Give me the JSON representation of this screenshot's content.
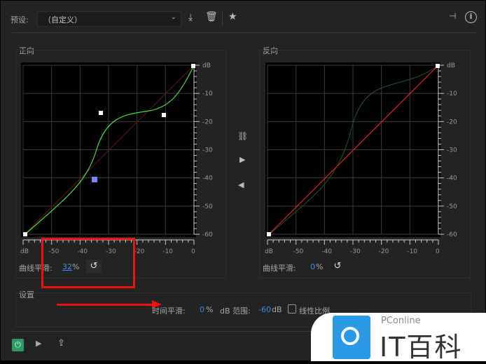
{
  "header": {
    "preset_label": "预设:",
    "preset_value": "（自定义）"
  },
  "forward": {
    "title": "正向",
    "smooth_label": "曲线平滑:",
    "smooth_value": "32",
    "unit": "%"
  },
  "reverse": {
    "title": "反向",
    "smooth_label": "曲线平滑:",
    "smooth_value": "0",
    "unit": "%"
  },
  "axis": {
    "y_labels": [
      "dB",
      "-10",
      "-20",
      "-30",
      "-40",
      "-50",
      "-60"
    ],
    "x_labels": [
      "dB",
      "-50",
      "-40",
      "-30",
      "-20",
      "-10",
      "0"
    ]
  },
  "settings": {
    "title": "设置",
    "time_smooth_label": "时间平滑:",
    "time_smooth_value": "0",
    "time_unit": "%",
    "range_label": "dB 范围:",
    "range_value": "-60",
    "range_unit": "dB",
    "linear_label": "线性比例"
  },
  "watermark": {
    "brand": "PConline",
    "name": "IT百科"
  },
  "colors": {
    "curve": "#3ee23e",
    "diag": "#e02020",
    "accent": "#3d8ee8"
  }
}
